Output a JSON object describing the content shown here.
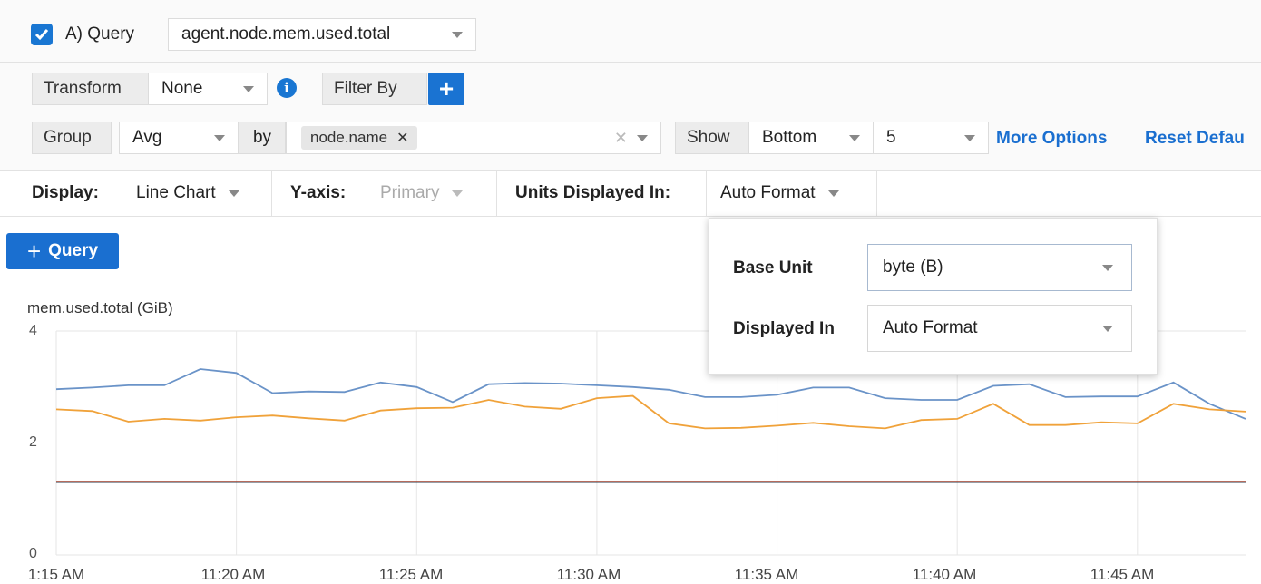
{
  "query": {
    "checked": true,
    "label": "A) Query",
    "metric": "agent.node.mem.used.total"
  },
  "transform": {
    "label": "Transform",
    "value": "None"
  },
  "filter": {
    "label": "Filter By",
    "add_icon": "plus-icon"
  },
  "group": {
    "label": "Group",
    "aggregation": "Avg",
    "by_label": "by",
    "tags": [
      "node.name"
    ],
    "show_label": "Show",
    "show_value": "Bottom",
    "count": "5"
  },
  "links": {
    "more_options": "More Options",
    "reset_defaults": "Reset Defau"
  },
  "display": {
    "label": "Display:",
    "value": "Line Chart",
    "yaxis_label": "Y-axis:",
    "yaxis_value": "Primary",
    "units_label": "Units Displayed In:",
    "units_value": "Auto Format"
  },
  "add_query": {
    "label": "Query"
  },
  "units_popover": {
    "base_unit_label": "Base Unit",
    "base_unit_value": "byte (B)",
    "displayed_in_label": "Displayed In",
    "displayed_in_value": "Auto Format"
  },
  "colors": {
    "accent": "#1a6fd0"
  },
  "chart_data": {
    "type": "line",
    "title": "mem.used.total (GiB)",
    "xlabel": "",
    "ylabel": "",
    "ylim": [
      0,
      4
    ],
    "yticks": [
      "0",
      "2",
      "4"
    ],
    "xticks": [
      "1:15 AM",
      "11:20 AM",
      "11:25 AM",
      "11:30 AM",
      "11:35 AM",
      "11:40 AM",
      "11:45 AM"
    ],
    "xlim": [
      0,
      33
    ],
    "grid": true,
    "x": [
      0,
      1,
      2,
      3,
      4,
      5,
      6,
      7,
      8,
      9,
      10,
      11,
      12,
      13,
      14,
      15,
      16,
      17,
      18,
      19,
      20,
      21,
      22,
      23,
      24,
      25,
      26,
      27,
      28,
      29,
      30,
      31,
      32,
      33
    ],
    "series": [
      {
        "color": "#6a93c8",
        "values": [
          2.96,
          2.99,
          3.03,
          3.03,
          3.32,
          3.25,
          2.89,
          2.92,
          2.91,
          3.08,
          3.0,
          2.73,
          3.05,
          3.07,
          3.06,
          3.03,
          3.0,
          2.95,
          2.82,
          2.82,
          2.86,
          2.99,
          2.99,
          2.8,
          2.77,
          2.77,
          3.02,
          3.05,
          2.82,
          2.83,
          2.83,
          3.08,
          2.7,
          2.43
        ]
      },
      {
        "color": "#f0a23a",
        "values": [
          2.6,
          2.57,
          2.38,
          2.43,
          2.4,
          2.46,
          2.49,
          2.44,
          2.4,
          2.58,
          2.62,
          2.63,
          2.77,
          2.65,
          2.61,
          2.8,
          2.84,
          2.35,
          2.26,
          2.27,
          2.31,
          2.36,
          2.3,
          2.26,
          2.41,
          2.43,
          2.7,
          2.32,
          2.32,
          2.37,
          2.35,
          2.7,
          2.6,
          2.56
        ]
      },
      {
        "color": "#b23a1e",
        "values": [
          1.31,
          1.31,
          1.31,
          1.31,
          1.31,
          1.31,
          1.31,
          1.31,
          1.31,
          1.31,
          1.31,
          1.31,
          1.31,
          1.31,
          1.31,
          1.31,
          1.31,
          1.31,
          1.31,
          1.31,
          1.31,
          1.31,
          1.31,
          1.31,
          1.31,
          1.31,
          1.31,
          1.31,
          1.31,
          1.31,
          1.31,
          1.31,
          1.31,
          1.31
        ]
      },
      {
        "color": "#2c3e50",
        "values": [
          1.3,
          1.3,
          1.3,
          1.3,
          1.3,
          1.3,
          1.3,
          1.3,
          1.3,
          1.3,
          1.3,
          1.3,
          1.3,
          1.3,
          1.3,
          1.3,
          1.3,
          1.3,
          1.3,
          1.3,
          1.3,
          1.3,
          1.3,
          1.3,
          1.3,
          1.3,
          1.3,
          1.3,
          1.3,
          1.3,
          1.3,
          1.3,
          1.3,
          1.3
        ]
      }
    ]
  }
}
